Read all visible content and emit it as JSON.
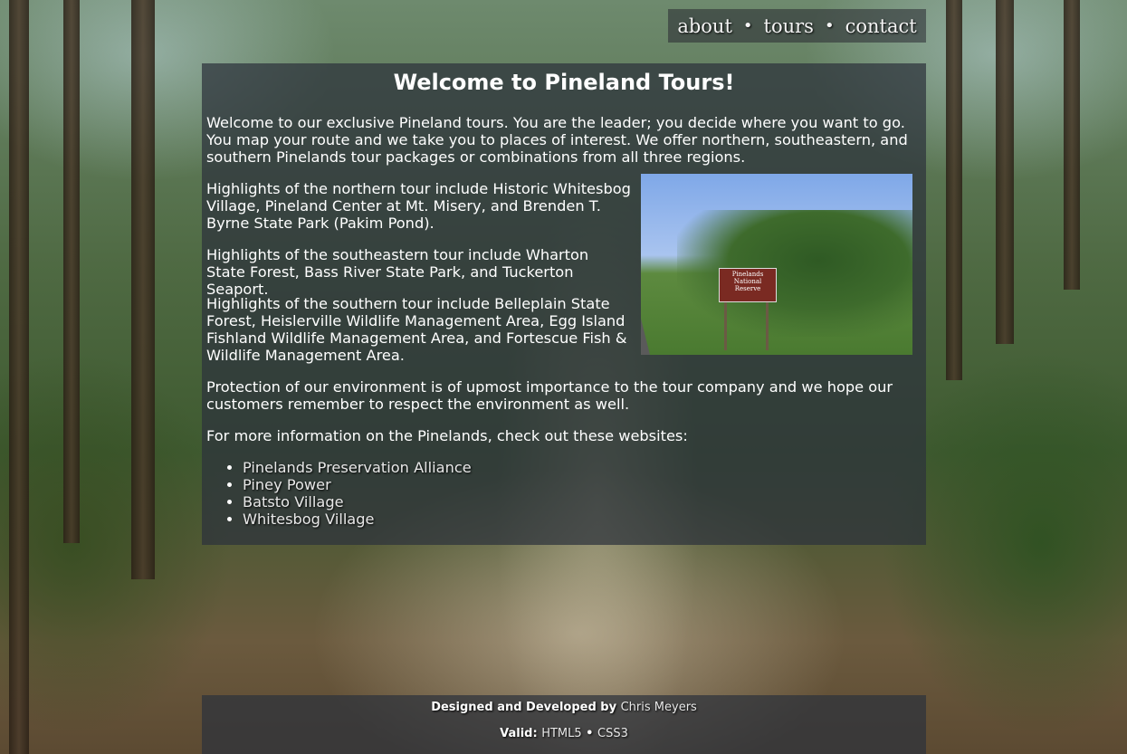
{
  "nav": {
    "items": [
      {
        "label": "about"
      },
      {
        "label": "tours"
      },
      {
        "label": "contact"
      }
    ],
    "separator": "•"
  },
  "main": {
    "title": "Welcome to Pineland Tours!",
    "intro": "Welcome to our exclusive Pineland tours. You are the leader; you decide where you want to go. You map your route and we take you to places of interest. We offer northern, southeastern, and southern Pinelands tour packages or combinations from all three regions.",
    "north": "Highlights of the northern tour include Historic Whitesbog Village, Pineland Center at Mt. Misery, and Brenden T. Byrne State Park (Pakim Pond).",
    "southeast": "Highlights of the southeastern tour include Wharton State Forest, Bass River State Park, and Tuckerton Seaport.",
    "south": "Highlights of the southern tour include Belleplain State Forest, Heislerville Wildlife Management Area, Egg Island Fishland Wildlife Management Area, and Fortescue Fish & Wildlife Management Area.",
    "protection": "Protection of our environment is of upmost importance to the tour company and we hope our customers remember to respect the environment as well.",
    "more_info": "For more information on the Pinelands, check out these websites:",
    "photo": {
      "sign_line1": "Pinelands",
      "sign_line2": "National",
      "sign_line3": "Reserve"
    },
    "links": [
      {
        "label": "Pinelands Preservation Alliance"
      },
      {
        "label": "Piney Power"
      },
      {
        "label": "Batsto Village"
      },
      {
        "label": "Whitesbog Village"
      }
    ]
  },
  "footer": {
    "designed_prefix": "Designed and Developed by",
    "author": "Chris Meyers",
    "valid_prefix": "Valid:",
    "html5": "HTML5",
    "separator": "•",
    "css3": "CSS3"
  }
}
